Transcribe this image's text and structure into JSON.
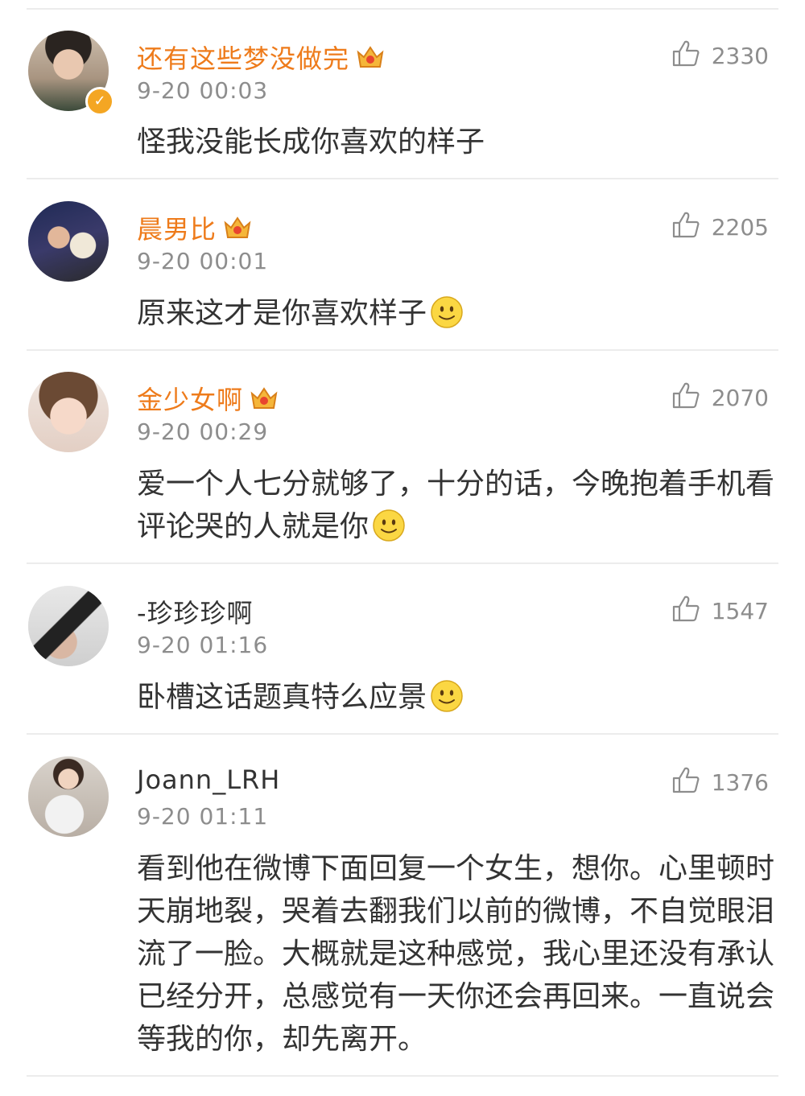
{
  "comments": [
    {
      "username": "还有这些梦没做完",
      "vip": true,
      "verified": true,
      "time": "9-20 00:03",
      "likes": "2330",
      "content": "怪我没能长成你喜欢的样子",
      "emoji": false
    },
    {
      "username": "晨男比",
      "vip": true,
      "verified": false,
      "time": "9-20 00:01",
      "likes": "2205",
      "content": "原来这才是你喜欢样子",
      "emoji": true
    },
    {
      "username": "金少女啊",
      "vip": true,
      "verified": false,
      "time": "9-20 00:29",
      "likes": "2070",
      "content": "爱一个人七分就够了，十分的话，今晚抱着手机看评论哭的人就是你",
      "emoji": true
    },
    {
      "username": "-珍珍珍啊",
      "vip": false,
      "verified": false,
      "time": "9-20 01:16",
      "likes": "1547",
      "content": "卧槽这话题真特么应景",
      "emoji": true
    },
    {
      "username": "Joann_LRH",
      "vip": false,
      "verified": false,
      "time": "9-20 01:11",
      "likes": "1376",
      "content": "看到他在微博下面回复一个女生，想你。心里顿时天崩地裂，哭着去翻我们以前的微博，不自觉眼泪流了一脸。大概就是这种感觉，我心里还没有承认已经分开，总感觉有一天你还会再回来。一直说会等我的你，却先离开。",
      "emoji": false
    }
  ],
  "icons": {
    "like": "thumbs-up-icon",
    "vip": "crown-icon",
    "verified": "verified-badge-icon",
    "emoji": "smile-emoji-icon"
  },
  "colors": {
    "vip_name": "#ee7b1b",
    "normal_name": "#333333",
    "meta": "#8d8d8d",
    "divider": "#ececec",
    "verified": "#f4a623"
  }
}
